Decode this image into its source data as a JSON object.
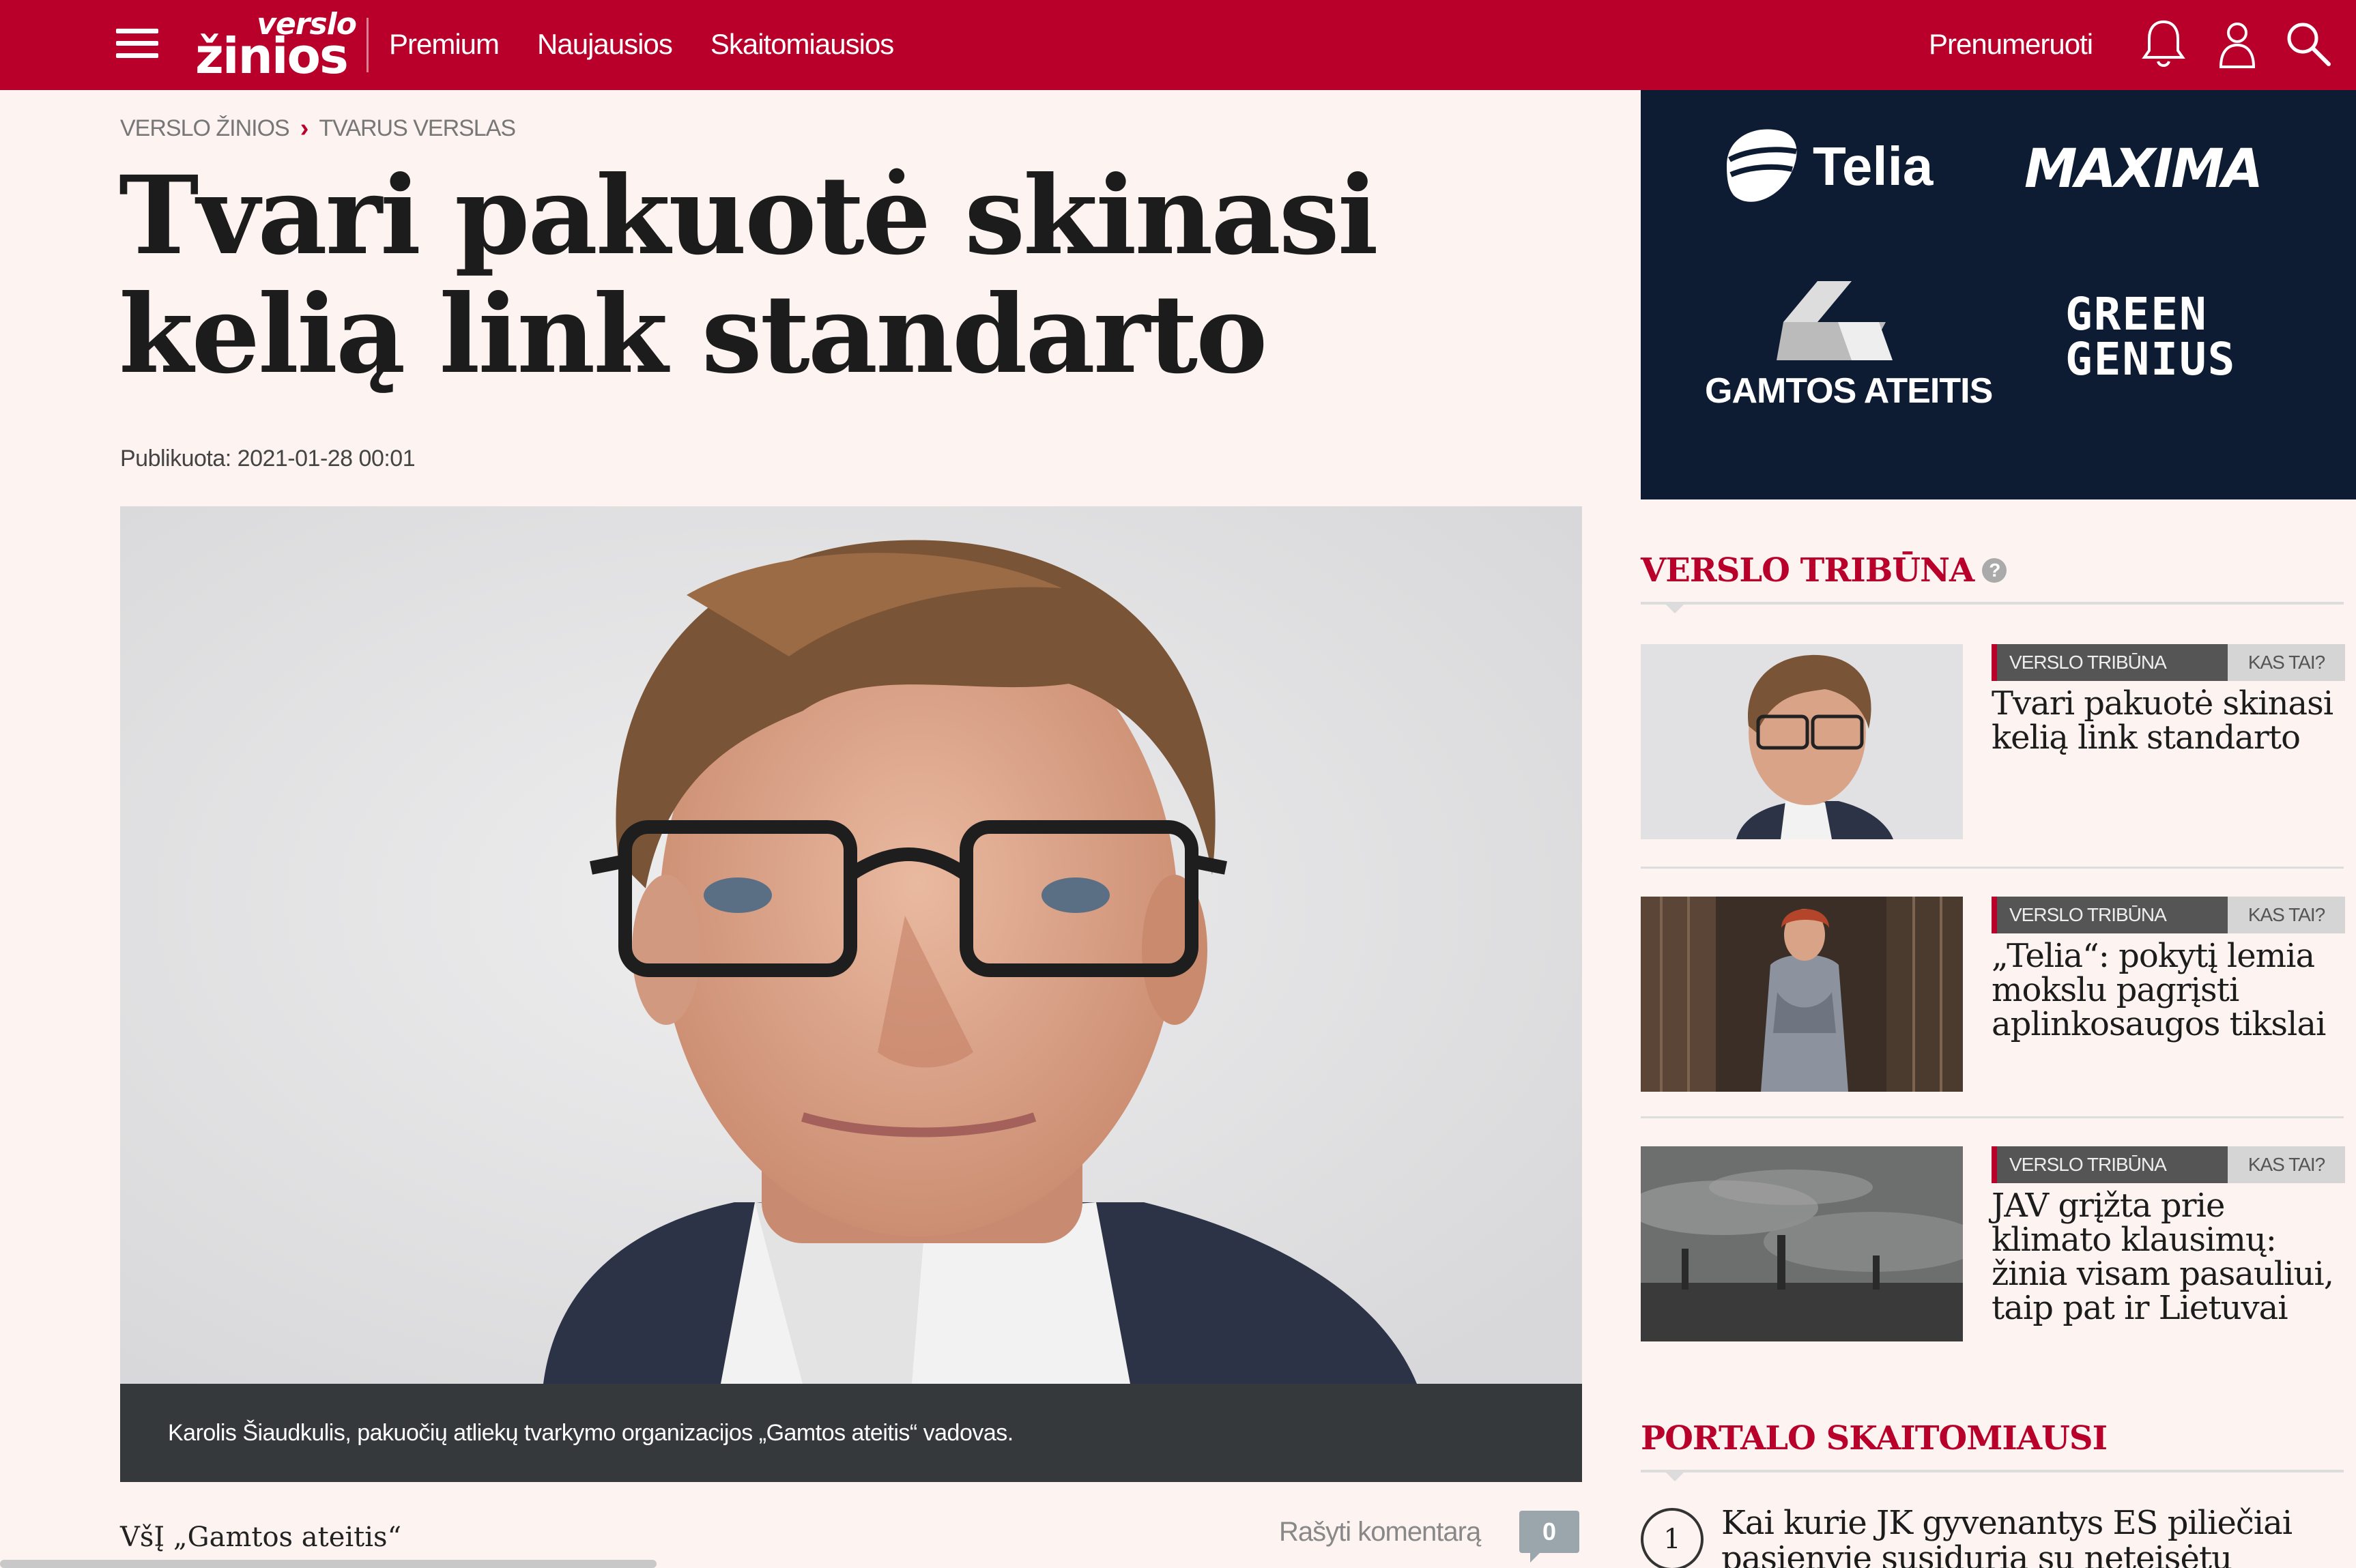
{
  "header": {
    "nav": [
      "Premium",
      "Naujausios",
      "Skaitomiausios"
    ],
    "subscribe": "Prenumeruoti",
    "logo_top": "verslo",
    "logo_bottom": "žinios",
    "brand_color": "#b8002a"
  },
  "breadcrumb": [
    "VERSLO ŽINIOS",
    "TVARUS VERSLAS"
  ],
  "article": {
    "title": "Tvari pakuotė skinasi kelią link standarto",
    "published": "Publikuota: 2021-01-28 00:01",
    "caption": "Karolis Šiaudkulis, pakuočių atliekų tvarkymo organizacijos „Gamtos ateitis“ vadovas.",
    "author": "VšĮ „Gamtos ateitis“",
    "comment_label": "Rašyti komentarą",
    "comment_count": "0"
  },
  "ad": {
    "brands": [
      "Telia",
      "MAXIMA",
      "GAMTOS ATEITIS",
      "GREEN",
      "GENIUS"
    ]
  },
  "sidebar": {
    "section_title": "VERSLO TRIBŪNA",
    "help_icon": "?",
    "cards": [
      {
        "tag": "VERSLO TRIBŪNA",
        "tag2": "KAS TAI?",
        "title": "Tvari pakuotė skinasi kelią link standarto"
      },
      {
        "tag": "VERSLO TRIBŪNA",
        "tag2": "KAS TAI?",
        "title": "„Telia“: pokytį lemia mokslu pagrįsti aplinkosaugos tikslai"
      },
      {
        "tag": "VERSLO TRIBŪNA",
        "tag2": "KAS TAI?",
        "title": "JAV grįžta prie klimato klausimų: žinia visam pasauliui, taip pat ir Lietuvai"
      }
    ],
    "popular_title": "PORTALO SKAITOMIAUSI",
    "popular": [
      {
        "rank": "1",
        "title": "Kai kurie JK gyvenantys ES piliečiai pasienyje susiduria su neteisėtu"
      }
    ]
  }
}
